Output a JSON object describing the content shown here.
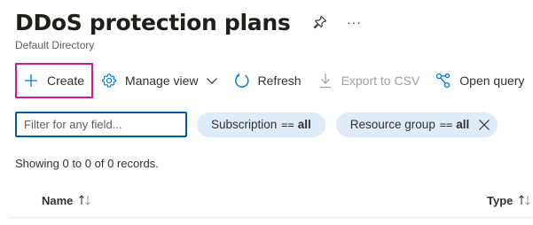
{
  "header": {
    "title": "DDoS protection plans",
    "subtitle": "Default Directory",
    "pin_icon": "pin-icon",
    "more_icon": "ellipsis-icon",
    "more_label": "···"
  },
  "toolbar": {
    "create_label": "Create",
    "manage_view_label": "Manage view",
    "refresh_label": "Refresh",
    "export_label": "Export to CSV",
    "open_query_label": "Open query"
  },
  "filters": {
    "search_placeholder": "Filter for any field...",
    "subscription": {
      "field": "Subscription",
      "operator": "==",
      "value": "all"
    },
    "resource_group": {
      "field": "Resource group",
      "operator": "==",
      "value": "all"
    }
  },
  "records_text": "Showing 0 to 0 of 0 records.",
  "table": {
    "columns": [
      {
        "label": "Name"
      },
      {
        "label": "Type"
      }
    ]
  },
  "colors": {
    "accent": "#0078d4",
    "focus_border": "#d01c8b",
    "pill_bg": "#deecf9",
    "disabled": "#a19f9d"
  }
}
